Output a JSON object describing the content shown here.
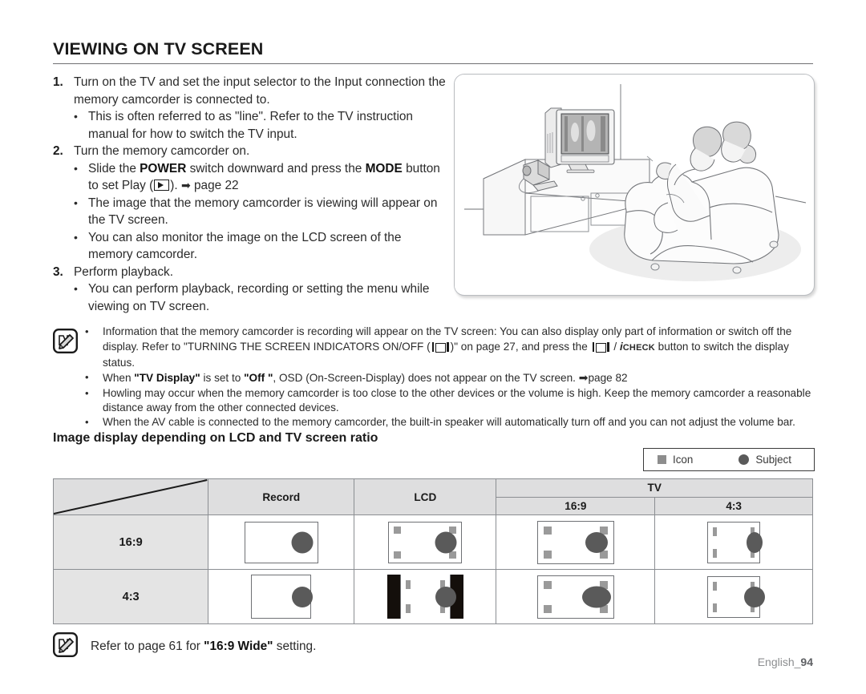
{
  "header": {
    "title": "VIEWING ON TV SCREEN"
  },
  "steps": [
    {
      "num": "1.",
      "text": "Turn on the TV and set the input selector to the Input connection the memory camcorder is connected to.",
      "bullets": [
        {
          "pre": "This is often referred to as \"line\". Refer to the TV instruction manual for how to switch the TV input."
        }
      ]
    },
    {
      "num": "2.",
      "text": "Turn the memory camcorder on.",
      "bullets": [
        {
          "pre": "Slide the ",
          "bold1": "POWER",
          "mid1": " switch downward and press the ",
          "bold2": "MODE",
          "mid2": " button to set Play (",
          "icon": "play-icon",
          "post": "). ",
          "arrow": "➡",
          "ref": " page 22"
        },
        {
          "pre": "The image that the memory camcorder is viewing will appear on the TV screen."
        },
        {
          "pre": "You can also monitor the image on the LCD screen of the memory camcorder."
        }
      ]
    },
    {
      "num": "3.",
      "text": "Perform playback.",
      "bullets": [
        {
          "pre": "You can perform playback, recording or setting the menu while viewing on TV screen."
        }
      ]
    }
  ],
  "illustration": {
    "alt": "living-room-tv-illustration",
    "icon_name": "tv-viewing-scene"
  },
  "note": {
    "icon_name": "note-pencil-icon",
    "bullets": [
      {
        "part1": "Information that the memory camcorder is recording will appear on the TV screen: You can also display only part of information or switch off the display. Refer to \"TURNING THE SCREEN INDICATORS ON/OFF (",
        "icon1": "display-icon",
        "part2": ")\" on page 27, and press the ",
        "icon2": "display-icon",
        "part3": " / ",
        "icheck_i": "i",
        "icheck_word": "CHECK",
        "part4": " button to switch the display status."
      },
      {
        "part1": "When ",
        "bold1": "\"TV Display\"",
        "part2": " is set to ",
        "bold2": "\"Off \"",
        "part3": ", OSD (On-Screen-Display) does not appear on the TV screen. ",
        "arrow": "➡",
        "part4": "page 82"
      },
      {
        "part1": "Howling may occur when the memory camcorder is too close to the other devices or the volume is high. Keep the memory camcorder a reasonable distance away from the other connected devices."
      },
      {
        "part1": "When the AV cable is connected to the memory camcorder, the built-in speaker will automatically turn off and you can not adjust the volume bar."
      }
    ]
  },
  "section": {
    "heading": "Image display depending on LCD and TV screen ratio"
  },
  "legend": {
    "items": [
      {
        "swatch": "square",
        "label": "Icon",
        "color": "#8d8d8d"
      },
      {
        "swatch": "circle",
        "label": "Subject",
        "color": "#5a5a5a"
      }
    ]
  },
  "table": {
    "headers": {
      "corner": "",
      "record": "Record",
      "lcd": "LCD",
      "tv": "TV",
      "tv_169": "16:9",
      "tv_43": "4:3"
    },
    "rows": [
      {
        "label": "16:9"
      },
      {
        "label": "4:3"
      }
    ]
  },
  "footer_note": {
    "icon_name": "note-pencil-icon",
    "pre": "Refer to page 61 for ",
    "bold": "\"16:9 Wide\"",
    "post": " setting."
  },
  "page_number": {
    "language": "English_",
    "number": "94"
  }
}
